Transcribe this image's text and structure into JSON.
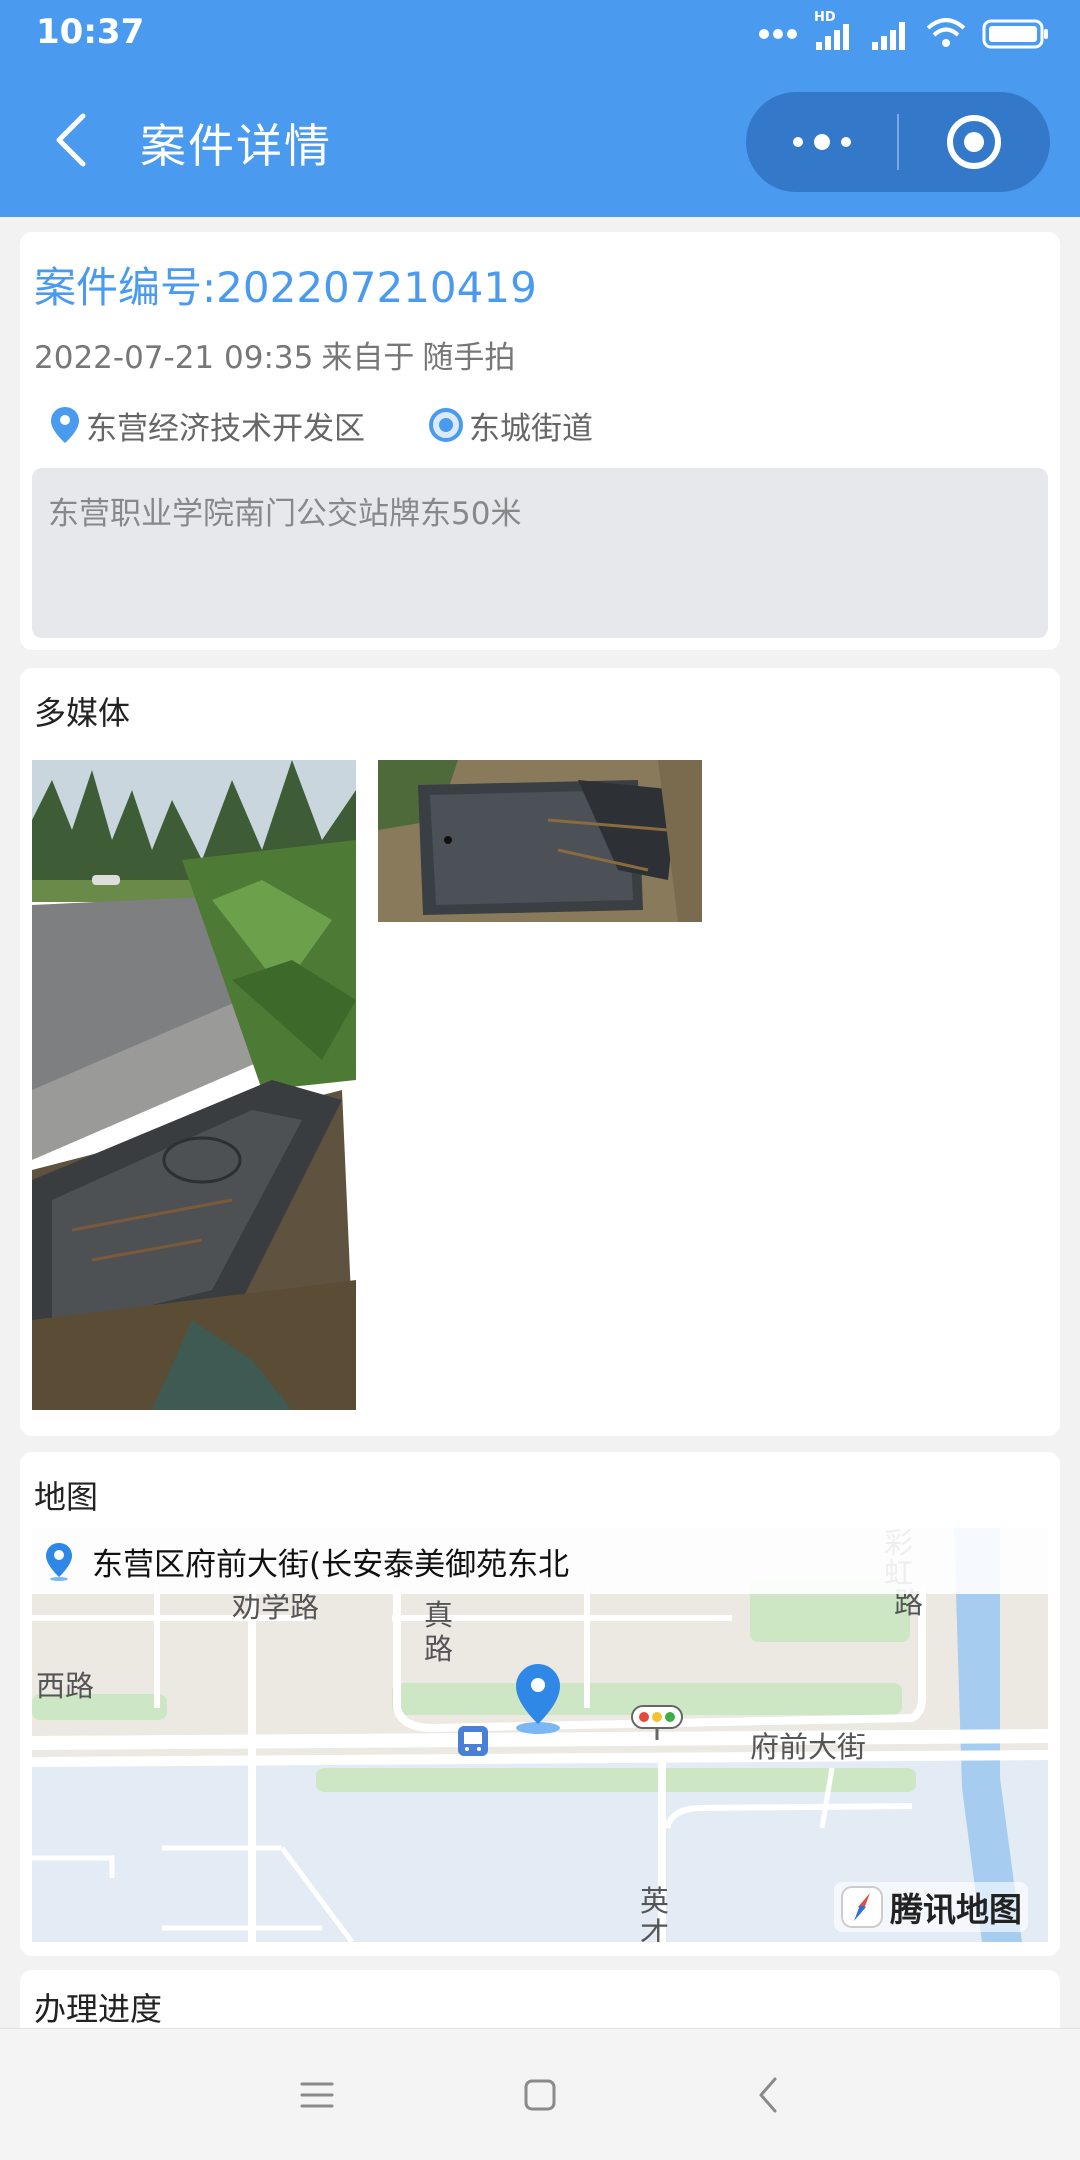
{
  "status_bar": {
    "time": "10:37",
    "network_label": "HD"
  },
  "nav": {
    "title": "案件详情"
  },
  "case": {
    "number_label": "案件编号:202207210419",
    "datetime": "2022-07-21 09:35",
    "source_prefix": "来自于",
    "source": "随手拍",
    "district": "东营经济技术开发区",
    "street": "东城街道",
    "address": "东营职业学院南门公交站牌东50米"
  },
  "media": {
    "title": "多媒体"
  },
  "map": {
    "title": "地图",
    "callout": "东营区府前大街(长安泰美御苑东北",
    "labels": {
      "road_xi": "西路",
      "road_quanxue": "劝学路",
      "road_zhen_1": "真",
      "road_zhen_2": "路",
      "road_fuqian": "府前大街",
      "road_caihong_1": "彩",
      "road_caihong_2": "虹",
      "road_caihong_3": "路",
      "road_ying_1": "英",
      "road_ying_2": "才"
    },
    "provider": "腾讯地图"
  },
  "progress": {
    "title": "办理进度"
  },
  "colors": {
    "primary": "#4a9bf0",
    "capsule": "#3479c9"
  },
  "icons": {
    "back": "chevron-left-icon",
    "more": "more-dots-icon",
    "close": "target-circle-icon",
    "district": "map-pin-icon",
    "street": "location-target-icon",
    "nav_menu": "menu-lines-icon",
    "nav_home": "square-icon",
    "nav_back": "chevron-left-icon"
  }
}
